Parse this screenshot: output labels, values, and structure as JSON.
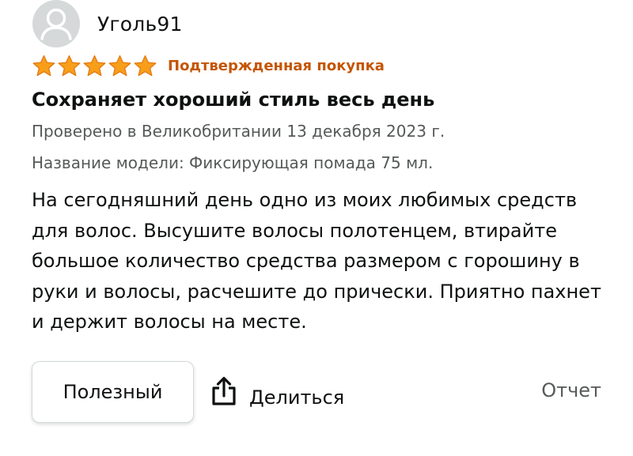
{
  "review": {
    "username": "Уголь91",
    "rating": 5,
    "rating_max": 5,
    "verified_label": "Подтвержденная покупка",
    "title": "Сохраняет хороший стиль весь день",
    "reviewed_in": "Проверено в Великобритании 13 декабря 2023 г.",
    "model_name": "Название модели: Фиксирующая помада 75 мл.",
    "body": "На сегодняшний день одно из моих любимых средств для волос. Высушите волосы полотенцем, втирайте большое количество средства размером с горошину в руки и волосы, расчешите до прически. Приятно пахнет и держит волосы на месте."
  },
  "actions": {
    "helpful_label": "Полезный",
    "share_label": "Делиться",
    "report_label": "Отчет"
  },
  "icons": {
    "avatar": "default-user-icon",
    "star": "star-icon",
    "share": "share-icon"
  },
  "colors": {
    "star": "#f79e1b",
    "verified": "#c45500",
    "meta_text": "#565959",
    "avatar_bg": "#d5d9d9"
  }
}
